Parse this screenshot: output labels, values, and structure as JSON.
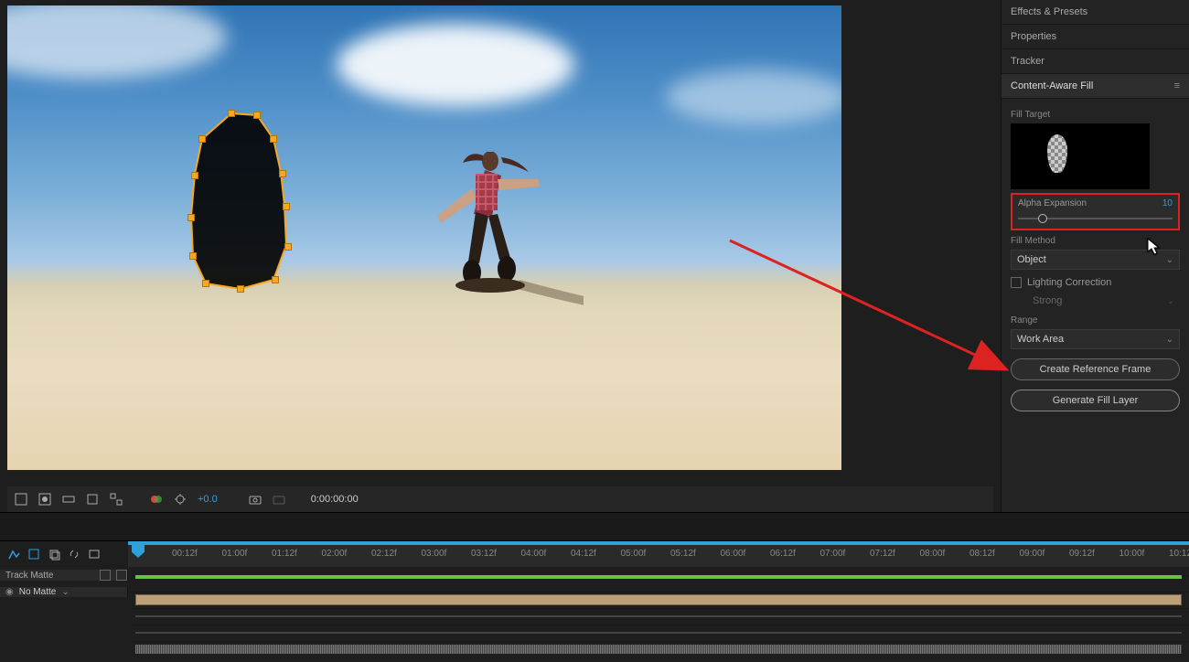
{
  "right_panel": {
    "tabs": [
      "Effects & Presets",
      "Properties",
      "Tracker"
    ],
    "active": "Content-Aware Fill",
    "fill_target_label": "Fill Target",
    "alpha_expansion": {
      "label": "Alpha Expansion",
      "value": "10"
    },
    "fill_method": {
      "label": "Fill Method",
      "value": "Object"
    },
    "lighting_correction": "Lighting Correction",
    "lighting_strength": "Strong",
    "range": {
      "label": "Range",
      "value": "Work Area"
    },
    "create_ref": "Create Reference Frame",
    "generate": "Generate Fill Layer"
  },
  "viewer_footer": {
    "offset": "+0.0",
    "timecode": "0:00:00:00"
  },
  "timeline": {
    "track_matte_label": "Track Matte",
    "no_matte": "No Matte",
    "ticks": [
      "00:12f",
      "01:00f",
      "01:12f",
      "02:00f",
      "02:12f",
      "03:00f",
      "03:12f",
      "04:00f",
      "04:12f",
      "05:00f",
      "05:12f",
      "06:00f",
      "06:12f",
      "07:00f",
      "07:12f",
      "08:00f",
      "08:12f",
      "09:00f",
      "09:12f",
      "10:00f",
      "10:12"
    ]
  }
}
